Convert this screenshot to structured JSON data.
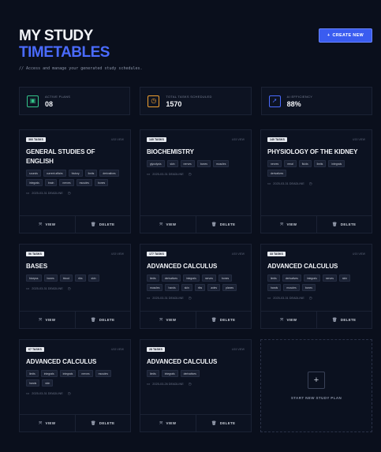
{
  "header": {
    "title_line1": "MY STUDY",
    "title_line2": "TIMETABLES",
    "subtitle": "// Access and manage your generated study schedules.",
    "create_button": "CREATE NEW",
    "create_icon": "+"
  },
  "colors": {
    "background": "#0a0f1c",
    "accent": "#3a5cf0",
    "accent_text": "#4a6bff",
    "stat_active": "#34c58a",
    "stat_tasks": "#f0a030",
    "stat_efficiency": "#4a6bff"
  },
  "stats": [
    {
      "label": "ACTIVE PLANS",
      "value": "08",
      "icon": "plans-icon",
      "glyph": "▣",
      "color": "#34c58a"
    },
    {
      "label": "TOTAL TASKS SCHEDULED",
      "value": "1570",
      "icon": "timer-icon",
      "glyph": "◷",
      "color": "#f0a030"
    },
    {
      "label": "AI EFFICIENCY",
      "value": "88%",
      "icon": "rocket-icon",
      "glyph": "➚",
      "color": "#4a6bff"
    }
  ],
  "cards": [
    {
      "badge": "366 TASKS",
      "date_top": "4/15 VIEW",
      "title": "GENERAL STUDIES OF ENGLISH",
      "tags": [
        "sounds",
        "current affairs",
        "history",
        "limits",
        "derivatives",
        "integrals",
        "brain",
        "nerves",
        "muscles",
        "bones"
      ],
      "deadline": "2025-03-31 DEADLINE"
    },
    {
      "badge": "140 TASKS",
      "date_top": "4/15 VIEW",
      "title": "BIOCHEMISTRY",
      "tags": [
        "glycolysis",
        "skin",
        "nerves",
        "bones",
        "muscles"
      ],
      "deadline": "2025-03-31 DEADLINE"
    },
    {
      "badge": "140 TASKS",
      "date_top": "4/15 VIEW",
      "title": "PHYSIOLOGY OF THE KIDNEY",
      "tags": [
        "nerves",
        "renal",
        "fluids",
        "limits",
        "integrals",
        "derivatives"
      ],
      "deadline": "2025-03-31 DEADLINE"
    },
    {
      "badge": "56 TASKS",
      "date_top": "4/15 VIEW",
      "title": "BASES",
      "tags": [
        "bicepss",
        "bones",
        "blood",
        "ribs",
        "skin"
      ],
      "deadline": "2025-03-31 DEADLINE"
    },
    {
      "badge": "177 TASKS",
      "date_top": "4/15 VIEW",
      "title": "ADVANCED CALCULUS",
      "tags": [
        "limits",
        "derivatives",
        "integrals",
        "nerves",
        "bones",
        "muscles",
        "hands",
        "skin",
        "ribs",
        "axles",
        "planes"
      ],
      "deadline": "2025-03-31 DEADLINE"
    },
    {
      "badge": "33 TASKS",
      "date_top": "4/15 VIEW",
      "title": "ADVANCED CALCULUS",
      "tags": [
        "limits",
        "derivatives",
        "integrals",
        "nerves",
        "skin",
        "hands",
        "muscles",
        "bones"
      ],
      "deadline": "2025-03-31 DEADLINE"
    },
    {
      "badge": "67 TASKS",
      "date_top": "4/15 VIEW",
      "title": "ADVANCED CALCULUS",
      "tags": [
        "limits",
        "integrals",
        "integrals",
        "nerves",
        "muscles",
        "hands",
        "skin"
      ],
      "deadline": "2025-03-31 DEADLINE"
    },
    {
      "badge": "28 TASKS",
      "date_top": "4/15 VIEW",
      "title": "ADVANCED CALCULUS",
      "tags": [
        "limits",
        "integrals",
        "derivatives"
      ],
      "deadline": "2025-03-26 DEADLINE"
    }
  ],
  "card_actions": {
    "view": "VIEW",
    "delete": "DELETE",
    "view_glyph": "⤧",
    "delete_glyph": "🗑"
  },
  "new_plan": {
    "label": "START NEW STUDY PLAN",
    "glyph": "+"
  }
}
